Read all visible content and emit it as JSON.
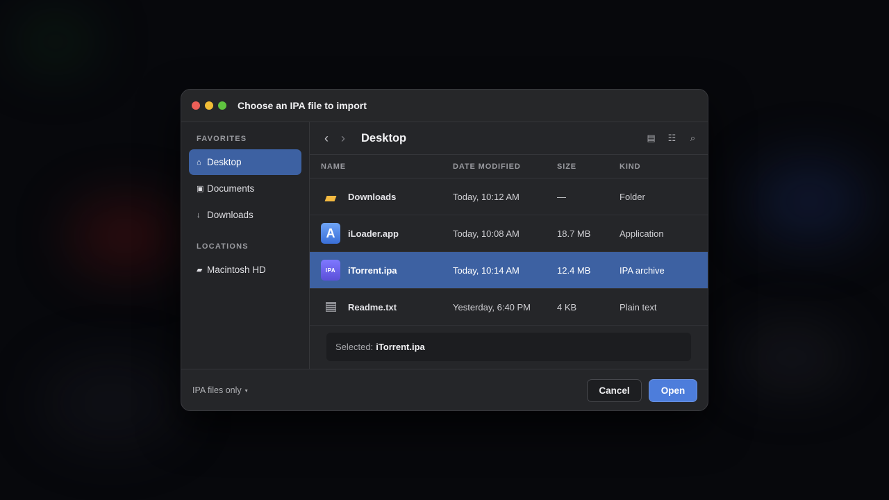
{
  "dialog": {
    "title": "Choose an IPA file to import"
  },
  "sidebar": {
    "favorites_label": "FAVORITES",
    "locations_label": "LOCATIONS",
    "favorites": [
      {
        "icon": "home-icon",
        "glyph": "⌂",
        "label": "Desktop"
      },
      {
        "icon": "documents-icon",
        "glyph": "▣",
        "label": "Documents"
      },
      {
        "icon": "download-arrow-icon",
        "glyph": "↓",
        "label": "Downloads"
      }
    ],
    "locations": [
      {
        "icon": "drive-icon",
        "glyph": "▰",
        "label": "Macintosh HD"
      }
    ]
  },
  "toolbar": {
    "back_glyph": "‹",
    "forward_glyph": "›",
    "path_title": "Desktop",
    "list_view_glyph": "▤",
    "grid_view_glyph": "☷",
    "search_glyph": "⌕"
  },
  "table": {
    "headers": {
      "name": "NAME",
      "date": "DATE MODIFIED",
      "size": "SIZE",
      "kind": "KIND"
    },
    "rows": [
      {
        "icon": "folder-icon",
        "name": "Downloads",
        "date": "Today, 10:12 AM",
        "size": "—",
        "kind": "Folder"
      },
      {
        "icon": "app-icon",
        "icon_text": "A",
        "name": "iLoader.app",
        "date": "Today, 10:08 AM",
        "size": "18.7 MB",
        "kind": "Application"
      },
      {
        "icon": "ipa-file-icon",
        "icon_text": "IPA",
        "name": "iTorrent.ipa",
        "date": "Today, 10:14 AM",
        "size": "12.4 MB",
        "kind": "IPA archive"
      },
      {
        "icon": "text-file-icon",
        "name": "Readme.txt",
        "date": "Yesterday, 6:40 PM",
        "size": "4 KB",
        "kind": "Plain text"
      }
    ]
  },
  "selection": {
    "label": "Selected:",
    "name": "iTorrent.ipa"
  },
  "footer": {
    "filter_label": "IPA files only",
    "filter_caret": "▾",
    "cancel_label": "Cancel",
    "open_label": "Open"
  },
  "colors": {
    "accent": "#3d61a2",
    "open_button": "#4d7ddb",
    "traffic_red": "#ec5f58",
    "traffic_yellow": "#f1bd36",
    "traffic_green": "#5fc33f"
  }
}
